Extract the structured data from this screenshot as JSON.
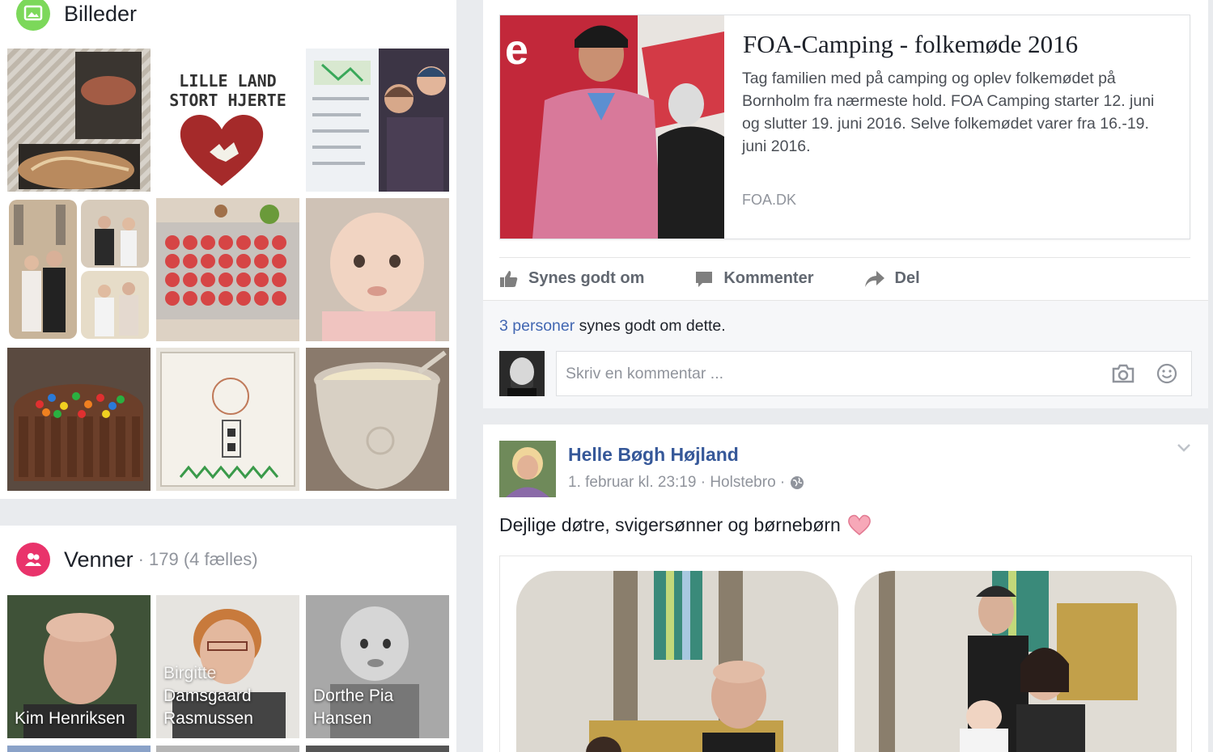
{
  "photos": {
    "title": "Billeder",
    "heart_sign_line1": "LILLE LAND",
    "heart_sign_line2": "STORT HJERTE"
  },
  "friends": {
    "title": "Venner",
    "count": "· 179 (4 fælles)",
    "items": [
      {
        "name": "Kim Henriksen"
      },
      {
        "name_line1": "Birgitte",
        "name_line2": "Damsgaard",
        "name_line3": "Rasmussen"
      },
      {
        "name_line1": "Dorthe Pia",
        "name_line2": "Hansen"
      }
    ]
  },
  "link_post": {
    "title": "FOA-Camping - folkemøde 2016",
    "description": "Tag familien med på camping og oplev folkemødet på Bornholm fra nærmeste hold. FOA Camping starter 12. juni og slutter 19. juni 2016. Selve folkemødet varer fra 16.-19. juni 2016.",
    "domain": "FOA.DK",
    "actions": {
      "like": "Synes godt om",
      "comment": "Kommenter",
      "share": "Del"
    },
    "likes_link": "3 personer",
    "likes_rest": " synes godt om dette.",
    "comment_placeholder": "Skriv en kommentar ..."
  },
  "post": {
    "author": "Helle Bøgh Højland",
    "meta": "1. februar kl. 23:19 · Holstebro ·",
    "text": "Dejlige døtre, svigersønner og børnebørn"
  },
  "colors": {
    "photos_icon": "#7cd85a",
    "friends_icon": "#e9336b",
    "link_blue": "#365899"
  },
  "icons": [
    "photos-icon",
    "friends-icon",
    "like-icon",
    "comment-icon",
    "share-icon",
    "camera-icon",
    "smiley-icon",
    "globe-icon",
    "chevron-down-icon",
    "heart-emoji-icon"
  ]
}
